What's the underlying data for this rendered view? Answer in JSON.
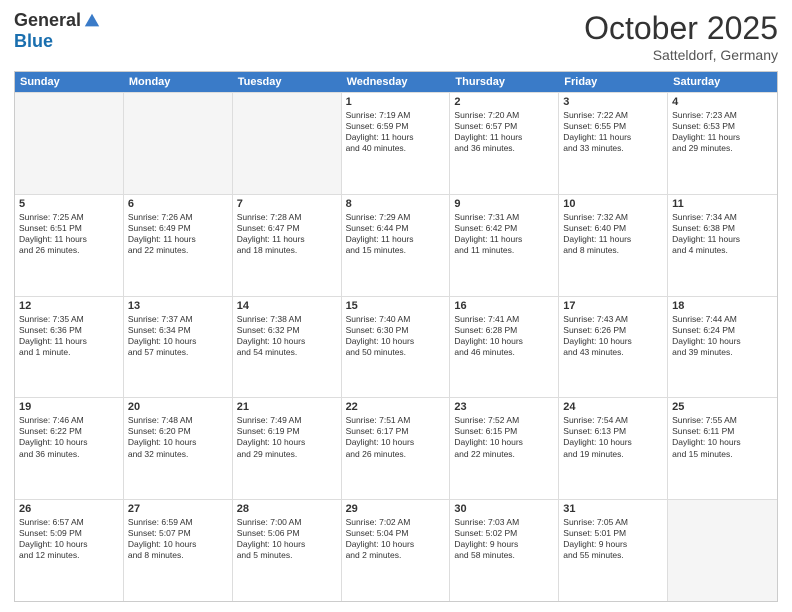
{
  "header": {
    "logo_general": "General",
    "logo_blue": "Blue",
    "month": "October 2025",
    "location": "Satteldorf, Germany"
  },
  "weekdays": [
    "Sunday",
    "Monday",
    "Tuesday",
    "Wednesday",
    "Thursday",
    "Friday",
    "Saturday"
  ],
  "rows": [
    [
      {
        "day": "",
        "info": ""
      },
      {
        "day": "",
        "info": ""
      },
      {
        "day": "",
        "info": ""
      },
      {
        "day": "1",
        "info": "Sunrise: 7:19 AM\nSunset: 6:59 PM\nDaylight: 11 hours\nand 40 minutes."
      },
      {
        "day": "2",
        "info": "Sunrise: 7:20 AM\nSunset: 6:57 PM\nDaylight: 11 hours\nand 36 minutes."
      },
      {
        "day": "3",
        "info": "Sunrise: 7:22 AM\nSunset: 6:55 PM\nDaylight: 11 hours\nand 33 minutes."
      },
      {
        "day": "4",
        "info": "Sunrise: 7:23 AM\nSunset: 6:53 PM\nDaylight: 11 hours\nand 29 minutes."
      }
    ],
    [
      {
        "day": "5",
        "info": "Sunrise: 7:25 AM\nSunset: 6:51 PM\nDaylight: 11 hours\nand 26 minutes."
      },
      {
        "day": "6",
        "info": "Sunrise: 7:26 AM\nSunset: 6:49 PM\nDaylight: 11 hours\nand 22 minutes."
      },
      {
        "day": "7",
        "info": "Sunrise: 7:28 AM\nSunset: 6:47 PM\nDaylight: 11 hours\nand 18 minutes."
      },
      {
        "day": "8",
        "info": "Sunrise: 7:29 AM\nSunset: 6:44 PM\nDaylight: 11 hours\nand 15 minutes."
      },
      {
        "day": "9",
        "info": "Sunrise: 7:31 AM\nSunset: 6:42 PM\nDaylight: 11 hours\nand 11 minutes."
      },
      {
        "day": "10",
        "info": "Sunrise: 7:32 AM\nSunset: 6:40 PM\nDaylight: 11 hours\nand 8 minutes."
      },
      {
        "day": "11",
        "info": "Sunrise: 7:34 AM\nSunset: 6:38 PM\nDaylight: 11 hours\nand 4 minutes."
      }
    ],
    [
      {
        "day": "12",
        "info": "Sunrise: 7:35 AM\nSunset: 6:36 PM\nDaylight: 11 hours\nand 1 minute."
      },
      {
        "day": "13",
        "info": "Sunrise: 7:37 AM\nSunset: 6:34 PM\nDaylight: 10 hours\nand 57 minutes."
      },
      {
        "day": "14",
        "info": "Sunrise: 7:38 AM\nSunset: 6:32 PM\nDaylight: 10 hours\nand 54 minutes."
      },
      {
        "day": "15",
        "info": "Sunrise: 7:40 AM\nSunset: 6:30 PM\nDaylight: 10 hours\nand 50 minutes."
      },
      {
        "day": "16",
        "info": "Sunrise: 7:41 AM\nSunset: 6:28 PM\nDaylight: 10 hours\nand 46 minutes."
      },
      {
        "day": "17",
        "info": "Sunrise: 7:43 AM\nSunset: 6:26 PM\nDaylight: 10 hours\nand 43 minutes."
      },
      {
        "day": "18",
        "info": "Sunrise: 7:44 AM\nSunset: 6:24 PM\nDaylight: 10 hours\nand 39 minutes."
      }
    ],
    [
      {
        "day": "19",
        "info": "Sunrise: 7:46 AM\nSunset: 6:22 PM\nDaylight: 10 hours\nand 36 minutes."
      },
      {
        "day": "20",
        "info": "Sunrise: 7:48 AM\nSunset: 6:20 PM\nDaylight: 10 hours\nand 32 minutes."
      },
      {
        "day": "21",
        "info": "Sunrise: 7:49 AM\nSunset: 6:19 PM\nDaylight: 10 hours\nand 29 minutes."
      },
      {
        "day": "22",
        "info": "Sunrise: 7:51 AM\nSunset: 6:17 PM\nDaylight: 10 hours\nand 26 minutes."
      },
      {
        "day": "23",
        "info": "Sunrise: 7:52 AM\nSunset: 6:15 PM\nDaylight: 10 hours\nand 22 minutes."
      },
      {
        "day": "24",
        "info": "Sunrise: 7:54 AM\nSunset: 6:13 PM\nDaylight: 10 hours\nand 19 minutes."
      },
      {
        "day": "25",
        "info": "Sunrise: 7:55 AM\nSunset: 6:11 PM\nDaylight: 10 hours\nand 15 minutes."
      }
    ],
    [
      {
        "day": "26",
        "info": "Sunrise: 6:57 AM\nSunset: 5:09 PM\nDaylight: 10 hours\nand 12 minutes."
      },
      {
        "day": "27",
        "info": "Sunrise: 6:59 AM\nSunset: 5:07 PM\nDaylight: 10 hours\nand 8 minutes."
      },
      {
        "day": "28",
        "info": "Sunrise: 7:00 AM\nSunset: 5:06 PM\nDaylight: 10 hours\nand 5 minutes."
      },
      {
        "day": "29",
        "info": "Sunrise: 7:02 AM\nSunset: 5:04 PM\nDaylight: 10 hours\nand 2 minutes."
      },
      {
        "day": "30",
        "info": "Sunrise: 7:03 AM\nSunset: 5:02 PM\nDaylight: 9 hours\nand 58 minutes."
      },
      {
        "day": "31",
        "info": "Sunrise: 7:05 AM\nSunset: 5:01 PM\nDaylight: 9 hours\nand 55 minutes."
      },
      {
        "day": "",
        "info": ""
      }
    ]
  ]
}
